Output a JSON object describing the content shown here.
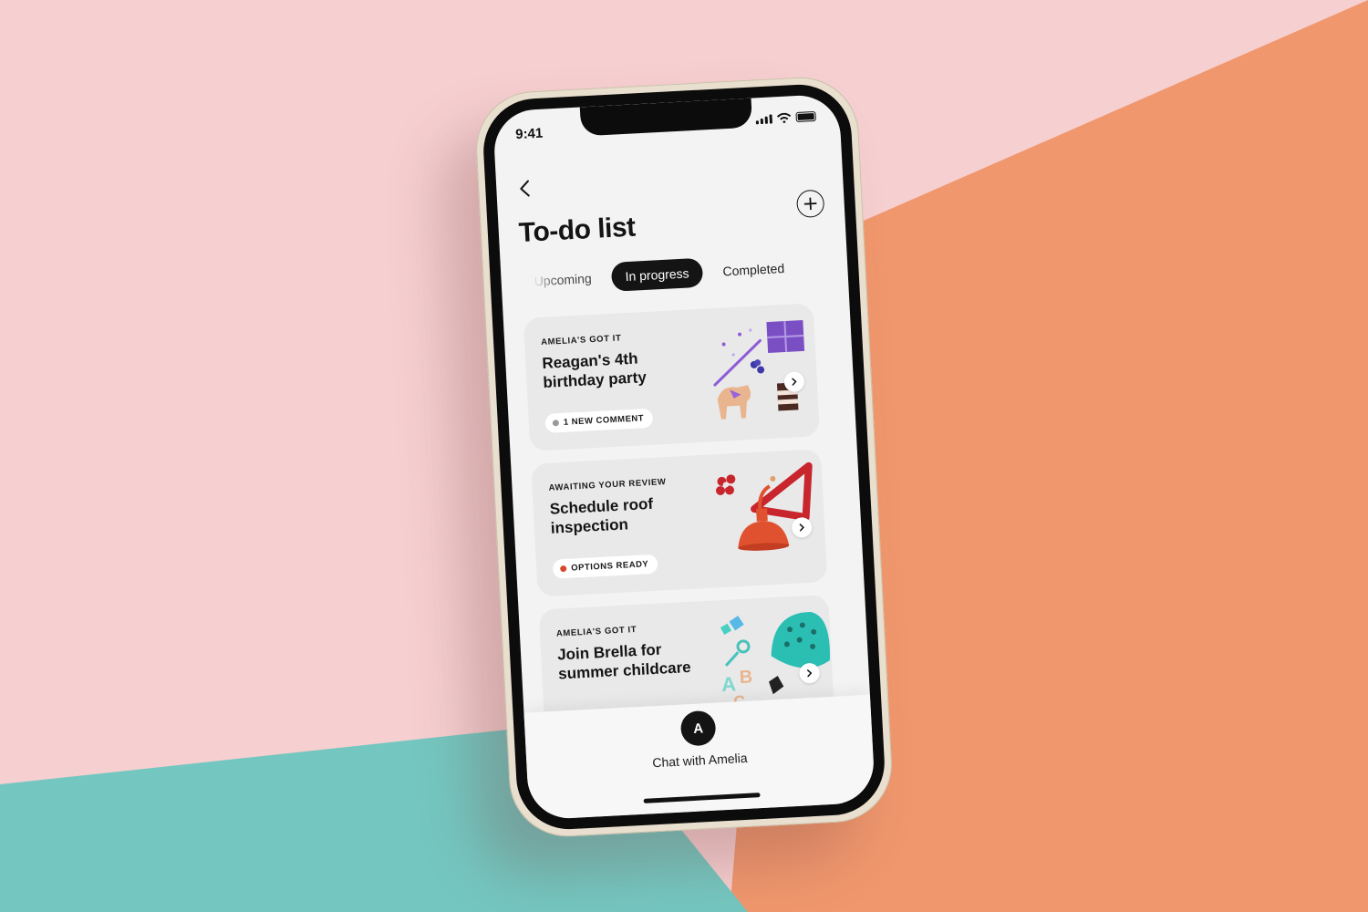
{
  "status": {
    "time": "9:41"
  },
  "header": {
    "title": "To-do list"
  },
  "tabs": [
    {
      "label": "Upcoming",
      "active": false
    },
    {
      "label": "In progress",
      "active": true
    },
    {
      "label": "Completed",
      "active": false
    }
  ],
  "cards": [
    {
      "eyebrow": "AMELIA'S GOT IT",
      "title": "Reagan's 4th birthday party",
      "badge": "1 NEW COMMENT",
      "badge_color": "#9a9a9a"
    },
    {
      "eyebrow": "AWAITING YOUR REVIEW",
      "title": "Schedule roof inspection",
      "badge": "OPTIONS READY",
      "badge_color": "#d6492a"
    },
    {
      "eyebrow": "AMELIA'S GOT IT",
      "title": "Join Brella for summer childcare",
      "badge": "",
      "badge_color": ""
    }
  ],
  "chat": {
    "avatar_initial": "A",
    "label": "Chat with Amelia"
  },
  "colors": {
    "bg_pink": "#f6cfd0",
    "bg_orange": "#f0976d",
    "bg_teal": "#74c7c0",
    "accent_dark": "#141414"
  },
  "icons": [
    "back-chevron-icon",
    "plus-icon",
    "chevron-right-icon",
    "signal-icon",
    "wifi-icon",
    "battery-icon"
  ]
}
